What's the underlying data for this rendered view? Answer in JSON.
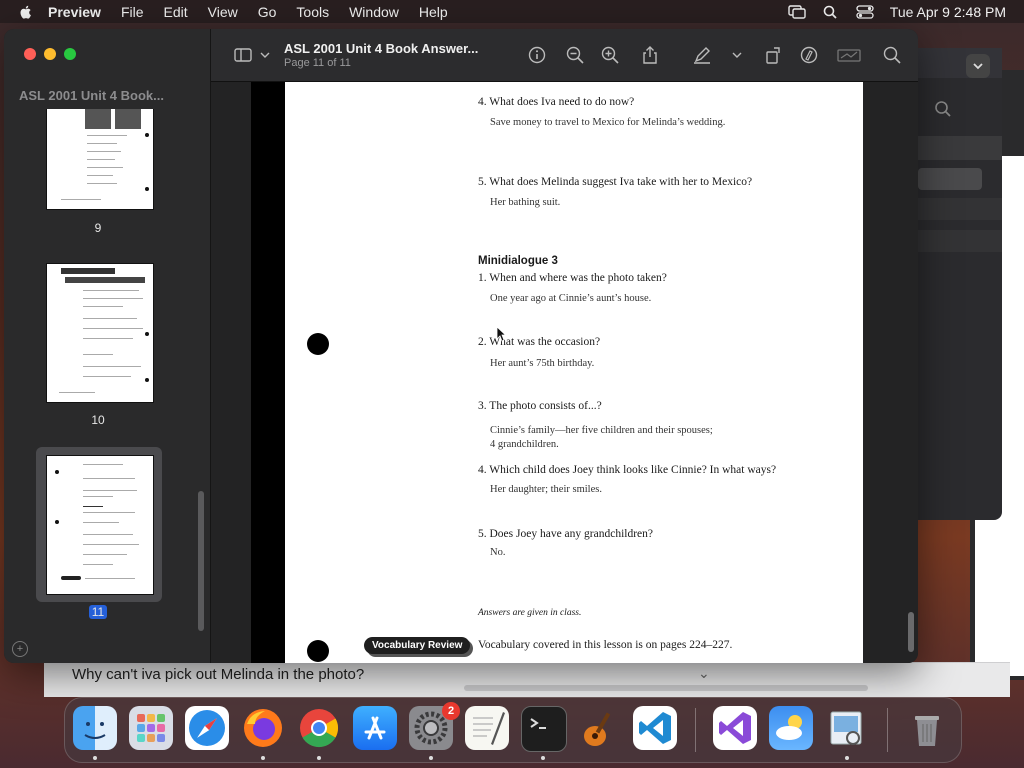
{
  "menubar": {
    "app_name": "Preview",
    "items": [
      "File",
      "Edit",
      "View",
      "Go",
      "Tools",
      "Window",
      "Help"
    ],
    "clock": "Tue Apr 9  2:48 PM"
  },
  "sidebar": {
    "title": "ASL 2001 Unit 4 Book...",
    "pages": [
      {
        "number": "9"
      },
      {
        "number": "10"
      },
      {
        "number": "11"
      }
    ]
  },
  "toolbar": {
    "doc_title": "ASL 2001 Unit 4 Book Answer...",
    "doc_subtitle": "Page 11 of 11"
  },
  "page": {
    "top_items": [
      {
        "q": "4. What does Iva need to do now?",
        "a": "Save money to travel to Mexico for Melinda’s wedding."
      },
      {
        "q": "5. What does Melinda suggest Iva take with her to Mexico?",
        "a": "Her bathing suit."
      }
    ],
    "section_heading": "Minidialogue 3",
    "section_items": [
      {
        "q": "1. When and where was the photo taken?",
        "a": "One year ago at Cinnie’s aunt’s house."
      },
      {
        "q": "2. What was the occasion?",
        "a": "Her aunt’s 75th birthday."
      },
      {
        "q": "3. The photo consists of...?",
        "a": "Cinnie’s family—her five children and their spouses;",
        "a2": "4 grandchildren."
      },
      {
        "q": "4. Which child does Joey think looks like Cinnie?  In what ways?",
        "a": "Her daughter; their smiles."
      },
      {
        "q": "5. Does Joey have any grandchildren?",
        "a": "No."
      }
    ],
    "note": "Answers are given in class.",
    "vocab_badge": "Vocabulary Review",
    "vocab_text": "Vocabulary covered in this lesson is on pages 224–227."
  },
  "background_window": {
    "question": "Why can't iva pick out Melinda in the photo?"
  },
  "dock": {
    "apps": [
      "finder",
      "launchpad",
      "safari",
      "firefox",
      "chrome",
      "app-store",
      "system-settings",
      "textedit",
      "terminal",
      "garageband",
      "vscode",
      "visual-studio",
      "weather",
      "preview"
    ],
    "system_settings_badge": "2",
    "trash": "trash"
  },
  "colors": {
    "accent_blue": "#2560d8",
    "close_red": "#ff5f57",
    "minimize_yellow": "#febc2e",
    "zoom_green": "#28c840"
  }
}
